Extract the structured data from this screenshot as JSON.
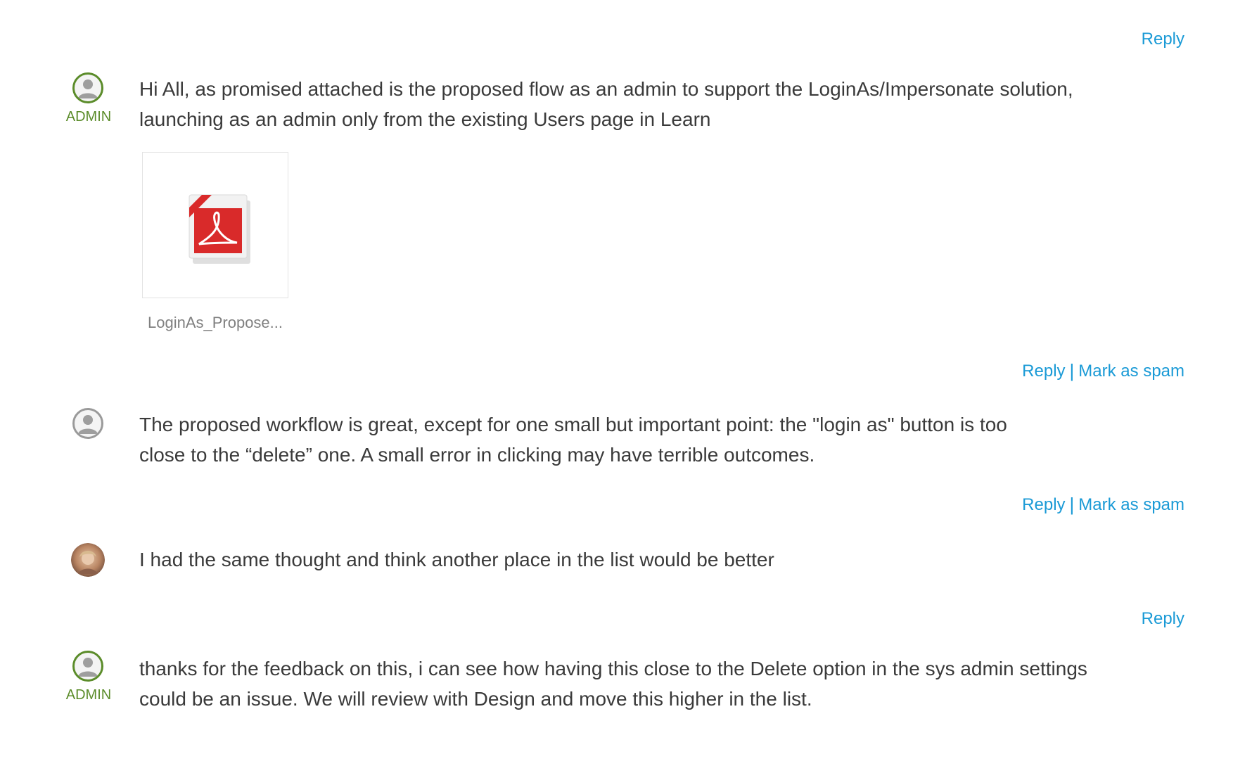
{
  "actions": {
    "reply": "Reply",
    "spam": "Mark as spam",
    "separator": "|"
  },
  "comments": [
    {
      "role": "ADMIN",
      "text_lines": [
        "Hi All, as promised attached is the proposed flow as an admin to support the LoginAs/Impersonate solution,",
        "launching as an admin only from the existing Users page in Learn"
      ],
      "attachment": {
        "name": "LoginAs_Propose...",
        "icon": "pdf-icon",
        "ribbon": "PDF"
      }
    },
    {
      "role": "",
      "text_lines": [
        "The proposed workflow is great, except for one small but important point: the \"login as\" button is too",
        "close to the “delete” one. A small error in clicking may have terrible outcomes."
      ]
    },
    {
      "role": "",
      "text_lines": [
        "I had the same thought and think another place in the list would be better"
      ]
    },
    {
      "role": "ADMIN",
      "text_lines": [
        "thanks for the feedback on this, i can see how having this close to the Delete option in the sys admin settings",
        "could be an issue. We will review with Design and move this higher in the list."
      ]
    }
  ],
  "colors": {
    "link": "#1a9ad6",
    "admin": "#5b8c2a",
    "text": "#3a3a3a",
    "pdf_red": "#d92a2a"
  }
}
